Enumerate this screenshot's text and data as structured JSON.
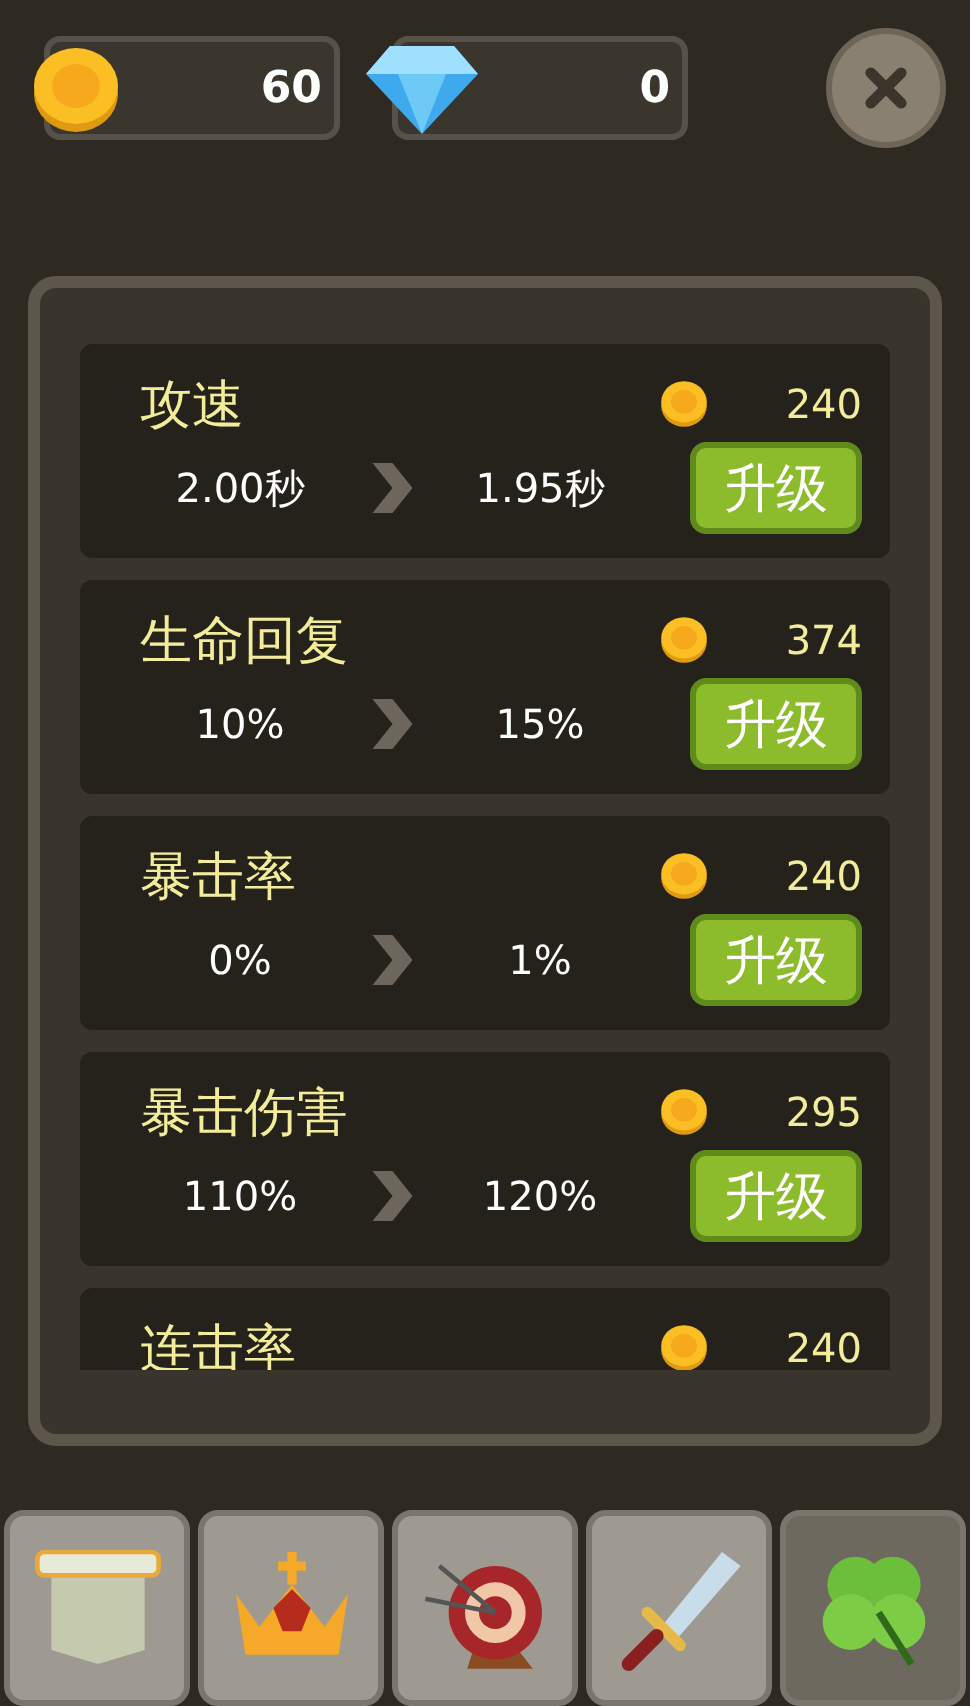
{
  "currencies": [
    {
      "kind": "coin",
      "amount": "60"
    },
    {
      "kind": "gem",
      "amount": "0"
    }
  ],
  "upgrades": [
    {
      "name": "攻速",
      "cost": "240",
      "from": "2.00秒",
      "to": "1.95秒",
      "button": "升级"
    },
    {
      "name": "生命回复",
      "cost": "374",
      "from": "10%",
      "to": "15%",
      "button": "升级"
    },
    {
      "name": "暴击率",
      "cost": "240",
      "from": "0%",
      "to": "1%",
      "button": "升级"
    },
    {
      "name": "暴击伤害",
      "cost": "295",
      "from": "110%",
      "to": "120%",
      "button": "升级"
    },
    {
      "name": "连击率",
      "cost": "240"
    }
  ],
  "tabs": [
    {
      "kind": "scroll",
      "selected": false
    },
    {
      "kind": "crown",
      "selected": false
    },
    {
      "kind": "target",
      "selected": false
    },
    {
      "kind": "sword",
      "selected": false
    },
    {
      "kind": "clover",
      "selected": true
    }
  ]
}
